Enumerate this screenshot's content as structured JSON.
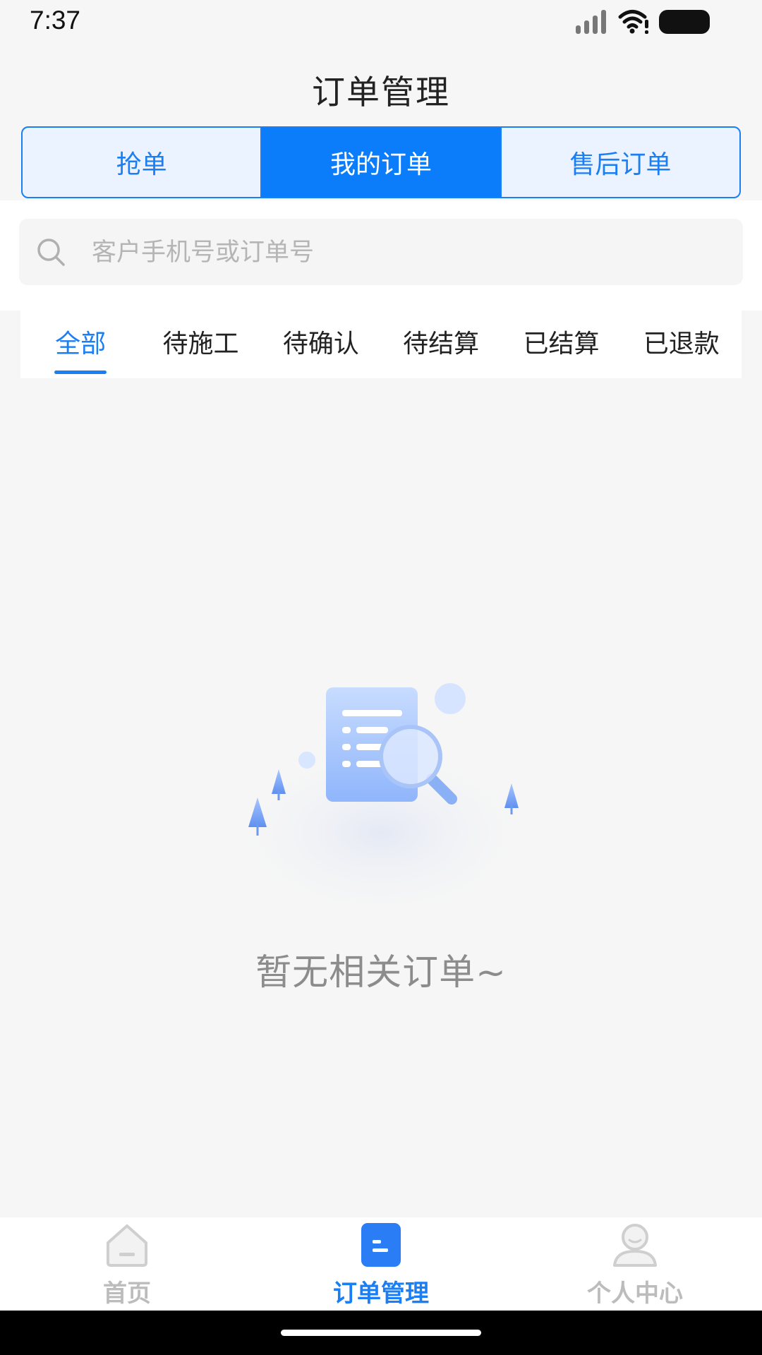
{
  "status_bar": {
    "time": "7:37"
  },
  "header": {
    "title": "订单管理"
  },
  "segments": [
    {
      "label": "抢单",
      "active": false
    },
    {
      "label": "我的订单",
      "active": true
    },
    {
      "label": "售后订单",
      "active": false
    }
  ],
  "search": {
    "placeholder": "客户手机号或订单号",
    "value": ""
  },
  "filters": [
    {
      "label": "全部",
      "active": true
    },
    {
      "label": "待施工",
      "active": false
    },
    {
      "label": "待确认",
      "active": false
    },
    {
      "label": "待结算",
      "active": false
    },
    {
      "label": "已结算",
      "active": false
    },
    {
      "label": "已退款",
      "active": false
    }
  ],
  "empty_state": {
    "message": "暂无相关订单~",
    "icon": "empty-document-search-illustration"
  },
  "bottom_nav": [
    {
      "label": "首页",
      "icon": "home-icon",
      "active": false
    },
    {
      "label": "订单管理",
      "icon": "order-icon",
      "active": true
    },
    {
      "label": "个人中心",
      "icon": "profile-icon",
      "active": false
    }
  ],
  "colors": {
    "accent": "#1a7ef5",
    "segment_active_bg": "#0b7dfb",
    "segment_bg": "#eaf3ff",
    "page_bg": "#f6f6f6",
    "muted_text": "#8c8c8c"
  }
}
